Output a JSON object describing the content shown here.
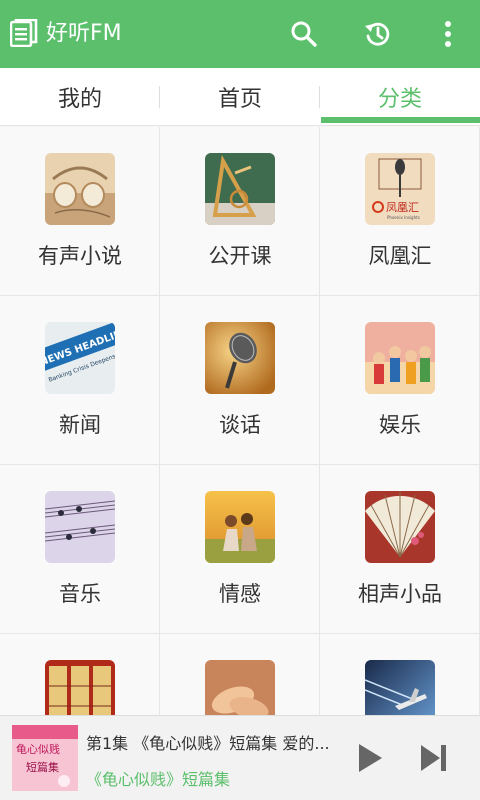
{
  "app": {
    "title": "好听FM"
  },
  "tabs": [
    {
      "label": "我的"
    },
    {
      "label": "首页"
    },
    {
      "label": "分类"
    }
  ],
  "categories": [
    {
      "label": "有声小说",
      "icon": "headphones-photo"
    },
    {
      "label": "公开课",
      "icon": "drafting-tools-photo"
    },
    {
      "label": "凤凰汇",
      "icon": "phoenix-microphone-photo",
      "thumb_text": [
        "凤凰汇",
        "Phoenix Insights"
      ]
    },
    {
      "label": "新闻",
      "icon": "news-headlines-photo",
      "thumb_text": [
        "NEWS HEADLINES",
        "Banking Crisis Deepens"
      ]
    },
    {
      "label": "谈话",
      "icon": "microphone-photo"
    },
    {
      "label": "娱乐",
      "icon": "people-illustration"
    },
    {
      "label": "音乐",
      "icon": "sheet-music-photo"
    },
    {
      "label": "情感",
      "icon": "couple-field-photo"
    },
    {
      "label": "相声小品",
      "icon": "folding-fan-photo"
    },
    {
      "label": "",
      "icon": "chinese-screen-photo"
    },
    {
      "label": "",
      "icon": "hands-photo"
    },
    {
      "label": "",
      "icon": "airplane-photo"
    }
  ],
  "player": {
    "episode_title": "第1集 《龟心似贱》短篇集 爱的...",
    "album_title": "《龟心似贱》短篇集",
    "cover_text": [
      "龟心似贱",
      "短篇集"
    ]
  },
  "colors": {
    "accent": "#5bbf6b",
    "background": "#f7f7f7"
  }
}
